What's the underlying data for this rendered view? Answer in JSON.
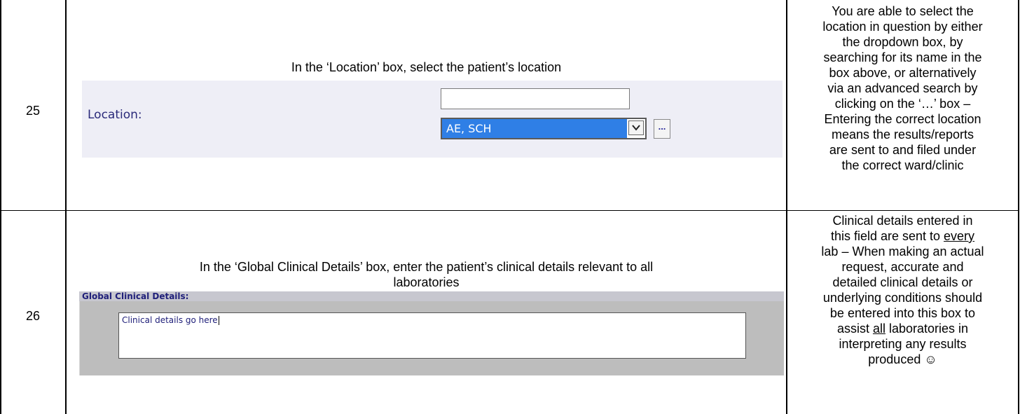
{
  "rows": [
    {
      "number": "25",
      "instruction": "In the ‘Location’ box, select the patient’s location",
      "notes": [
        "You are able to select the",
        "location in question by either",
        "the dropdown box, by",
        "searching for its name in the",
        "box above, or alternatively",
        "via an advanced search by",
        "clicking on the ‘…’ box –",
        "Entering the correct location",
        "means the results/reports",
        "are sent to and filed under",
        "the correct ward/clinic"
      ],
      "screenshot": {
        "label": "Location:",
        "search_value": "",
        "selected_option": "AE, SCH",
        "more_button": "..."
      }
    },
    {
      "number": "26",
      "instruction_lines": [
        "In the ‘Global Clinical Details’ box, enter the patient’s clinical details relevant to all",
        "laboratories"
      ],
      "notes_line1": "Clinical details entered in",
      "notes_line2_pre": "this field are sent to ",
      "notes_line2_u": "every",
      "notes_line3": "lab – When making an actual",
      "notes_line4": "request, accurate and",
      "notes_line5": "detailed clinical details or",
      "notes_line6": "underlying conditions should",
      "notes_line7": "be entered into this box to",
      "notes_line8_pre": "assist ",
      "notes_line8_u": "all",
      "notes_line8_post": " laboratories in",
      "notes_line9": "interpreting any results",
      "notes_line10": "produced ☺",
      "screenshot": {
        "title": "Global Clinical Details:",
        "text_value": "Clinical details go here"
      }
    }
  ]
}
